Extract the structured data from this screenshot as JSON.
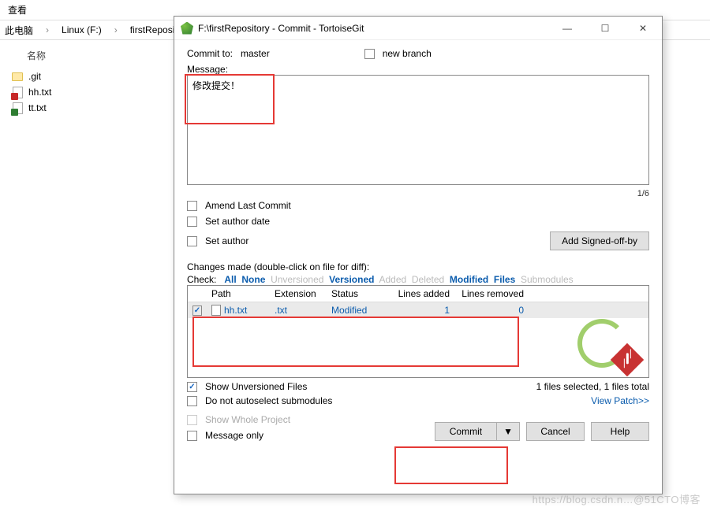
{
  "menu": {
    "view": "查看"
  },
  "breadcrumb": {
    "root": "此电脑",
    "drive": "Linux (F:)",
    "folder": "firstRepository"
  },
  "left_pane": {
    "col_name": "名称",
    "items": [
      {
        "name": ".git",
        "kind": "folder"
      },
      {
        "name": "hh.txt",
        "kind": "modified"
      },
      {
        "name": "tt.txt",
        "kind": "added"
      }
    ]
  },
  "dialog": {
    "title": "F:\\firstRepository - Commit - TortoiseGit",
    "commit_to_label": "Commit to:",
    "branch": "master",
    "new_branch_label": "new branch",
    "message_label": "Message:",
    "message_text": "修改提交！",
    "counter": "1/6",
    "amend": "Amend Last Commit",
    "set_date": "Set author date",
    "set_author": "Set author",
    "signed_off": "Add Signed-off-by",
    "changes_label": "Changes made (double-click on file for diff):",
    "check_label": "Check:",
    "filters": {
      "all": "All",
      "none": "None",
      "unversioned": "Unversioned",
      "versioned": "Versioned",
      "added": "Added",
      "deleted": "Deleted",
      "modified": "Modified",
      "files": "Files",
      "submodules": "Submodules"
    },
    "table": {
      "headers": {
        "path": "Path",
        "ext": "Extension",
        "status": "Status",
        "added": "Lines added",
        "removed": "Lines removed"
      },
      "rows": [
        {
          "path": "hh.txt",
          "ext": ".txt",
          "status": "Modified",
          "added": "1",
          "removed": "0"
        }
      ]
    },
    "status_summary": "1 files selected, 1 files total",
    "show_unversioned": "Show Unversioned Files",
    "no_autoselect": "Do not autoselect submodules",
    "view_patch": "View Patch>>",
    "show_whole": "Show Whole Project",
    "message_only": "Message only",
    "commit_btn": "Commit",
    "cancel_btn": "Cancel",
    "help_btn": "Help"
  },
  "page_watermark": "https://blog.csdn.n…@51CTO博客"
}
